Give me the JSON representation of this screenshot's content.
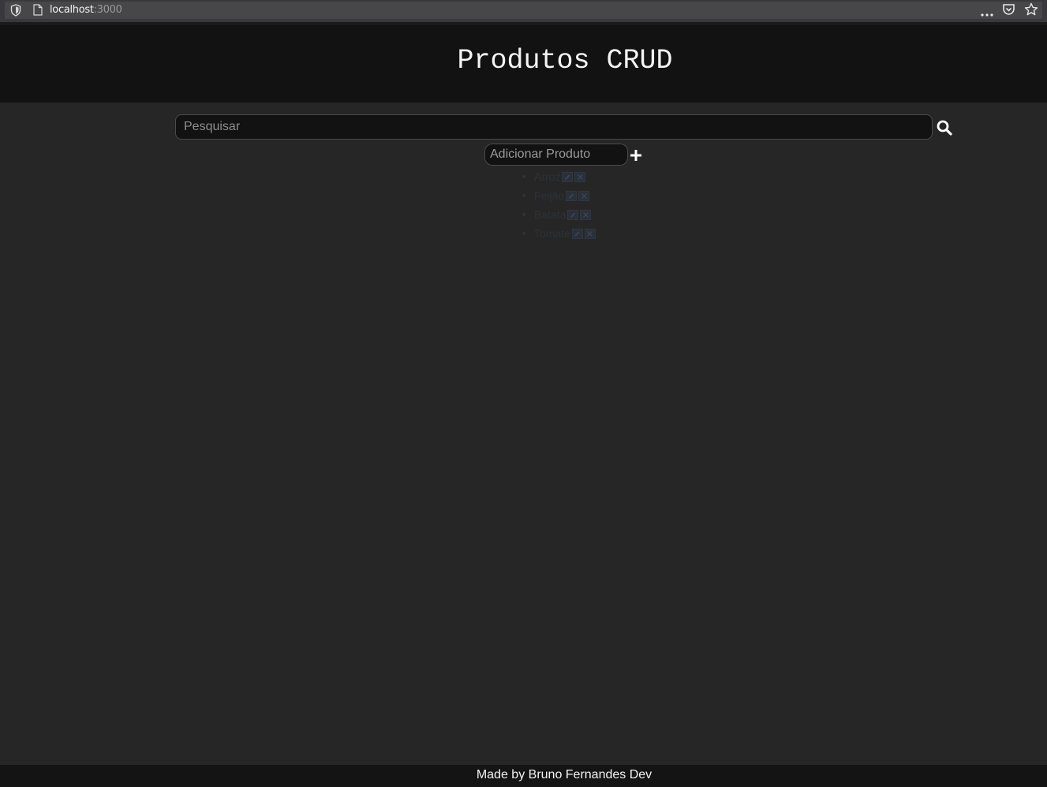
{
  "browser": {
    "url_host": "localhost",
    "url_port": ":3000"
  },
  "header": {
    "title": "Produtos CRUD"
  },
  "search": {
    "placeholder": "Pesquisar"
  },
  "add_product": {
    "placeholder": "Adicionar Produto"
  },
  "products": [
    {
      "name": "Arroz"
    },
    {
      "name": "Feijão"
    },
    {
      "name": "Batata"
    },
    {
      "name": "Tomate"
    }
  ],
  "footer": {
    "text": "Made by Bruno Fernandes Dev"
  },
  "colors": {
    "background": "#262626",
    "header_bg": "#121212",
    "footer_bg": "#141414",
    "text": "#f4f4f4"
  }
}
